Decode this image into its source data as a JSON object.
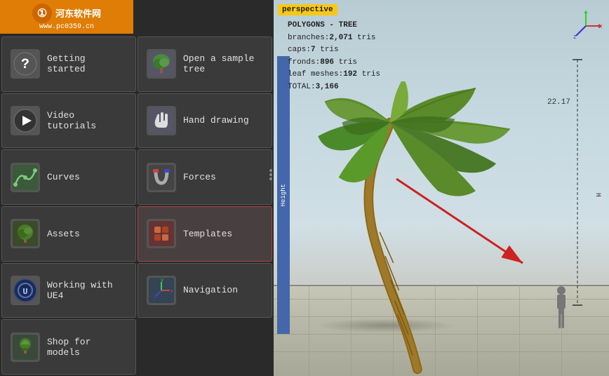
{
  "watermark": {
    "logo": "①",
    "title": "河东软件网",
    "url": "www.pc0359.cn"
  },
  "menu": {
    "items": [
      {
        "id": "getting-started",
        "label": "Getting started",
        "icon": "❓",
        "bg": "#3a3a3a"
      },
      {
        "id": "open-sample-tree",
        "label": "Open a sample tree",
        "icon": "🌿",
        "bg": "#3a3a3a"
      },
      {
        "id": "video-tutorials",
        "label": "Video tutorials",
        "icon": "▶",
        "bg": "#3a3a3a"
      },
      {
        "id": "hand-drawing",
        "label": "Hand drawing",
        "icon": "✋",
        "bg": "#3a3a3a"
      },
      {
        "id": "curves",
        "label": "Curves",
        "icon": "〜",
        "bg": "#3a3a3a"
      },
      {
        "id": "forces",
        "label": "Forces",
        "icon": "🔗",
        "bg": "#3a3a3a"
      },
      {
        "id": "assets",
        "label": "Assets",
        "icon": "🌿",
        "bg": "#3a3a3a"
      },
      {
        "id": "templates",
        "label": "Templates",
        "icon": "🔧",
        "bg": "#3a3a3a"
      },
      {
        "id": "working-with-ue4",
        "label": "Working with UE4",
        "icon": "⚙",
        "bg": "#3a3a3a"
      },
      {
        "id": "navigation",
        "label": "Navigation",
        "icon": "🌐",
        "bg": "#3a3a3a"
      },
      {
        "id": "shop-for-models",
        "label": "Shop for models",
        "icon": "🌱",
        "bg": "#3a3a3a"
      }
    ]
  },
  "viewport": {
    "perspective_label": "perspective",
    "poly_title": "POLYGONS - TREE",
    "branches_label": "branches:",
    "branches_value": "2,071",
    "branches_unit": " tris",
    "caps_label": "caps:",
    "caps_value": "7",
    "caps_unit": " tris",
    "fronds_label": "fronds:",
    "fronds_value": "896",
    "fronds_unit": " tris",
    "leaf_label": "leaf meshes:",
    "leaf_value": "192",
    "leaf_unit": " tris",
    "total_label": "TOTAL:",
    "total_value": "3,166",
    "height_value": "22.17",
    "height_text": "Height"
  }
}
